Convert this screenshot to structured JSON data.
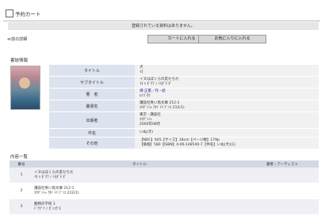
{
  "cart": {
    "title": "予約カート",
    "notice": "登録されている資料はありません。"
  },
  "nav": {
    "back_label": "≪前の詳細",
    "cart_button": "カートに入れる",
    "favorite_button": "お気に入りに入れる"
  },
  "book_info": {
    "section_title": "書誌情報",
    "rows": [
      {
        "label": "タイトル",
        "lines": [
          "犬",
          "ｲﾇ"
        ]
      },
      {
        "label": "サブタイトル",
        "lines": [
          "イヌはぼくらの友だちだ",
          "ｲﾇ ﾊ ﾎﾞｸﾗ ﾉ ﾄﾓﾀﾞﾁ ﾀﾞ"
        ]
      },
      {
        "label": "著　者",
        "lines": [
          "畑 正憲／作・絵",
          "ﾑﾂｺﾞﾛｳ"
        ]
      },
      {
        "label": "叢書名",
        "lines": [
          "講談社青い鳥文庫 212-1",
          "ｺｳﾀﾞﾝｼｬ ｱｵｲ ﾄﾘ ﾌﾞﾝｺ 212(1)"
        ]
      },
      {
        "label": "出版者",
        "lines": [
          "東京 : 講談社",
          "ｺｳﾀﾞﾝｼｬ",
          "2000年08月"
        ]
      },
      {
        "label": "件名",
        "lines": [
          "いぬ(犬)"
        ]
      },
      {
        "label": "その他",
        "lines": [
          "【NDC】645【サイズ】18cm【ページ数】179p",
          "【価格】580【ISBN】4-06-148540-7【件名】いぬ(犬)(1)"
        ]
      }
    ]
  },
  "contents": {
    "section_title": "内容一覧",
    "headers": {
      "number": "番号",
      "title": "タイトル",
      "author": "著者・アーティスト"
    },
    "rows": [
      {
        "number": "1",
        "title": "イヌはぼくらの友だちだ",
        "kana": "ｲﾇ ﾊ ﾎﾞｸﾗ ﾉ ﾄﾓﾀﾞﾁ ﾀﾞ"
      },
      {
        "number": "2",
        "title": "講談社青い鳥文庫 212-1",
        "kana": "ｺｳﾀﾞﾝｼｬ ｱｵｲ ﾄﾘ ﾌﾞﾝｺ 212(1)"
      },
      {
        "number": "3",
        "title": "動物の学校 1",
        "kana": "ﾄﾞｳﾌﾞﾂ ﾉ ｶﾞｯｺｳ 1"
      }
    ]
  }
}
